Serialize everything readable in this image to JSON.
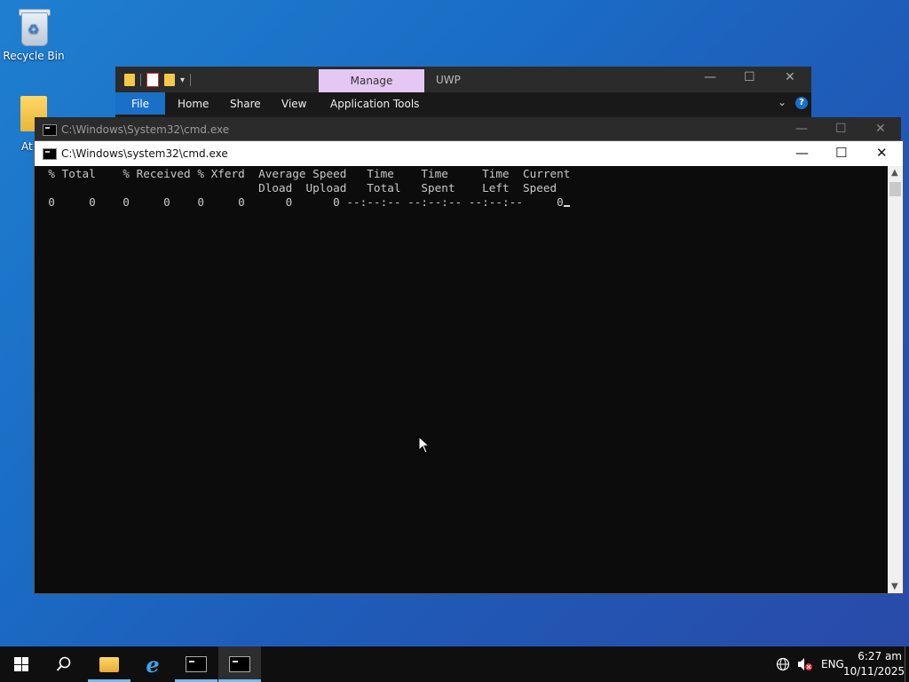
{
  "desktop": {
    "recycle_bin_label": "Recycle Bin",
    "folder_partial_label": "At"
  },
  "explorer": {
    "ribbon_context_tab": "Manage",
    "title_text": "UWP",
    "ribbon_tabs": [
      "File",
      "Home",
      "Share",
      "View",
      "Application Tools"
    ],
    "help_label": "?",
    "controls": {
      "minimize": "—",
      "maximize": "☐",
      "close": "✕"
    }
  },
  "cmd_back": {
    "title": "C:\\Windows\\System32\\cmd.exe",
    "controls": {
      "minimize": "—",
      "maximize": "☐",
      "close": "✕"
    }
  },
  "cmd_front": {
    "title": "C:\\Windows\\system32\\cmd.exe",
    "controls": {
      "minimize": "—",
      "maximize": "☐",
      "close": "✕"
    },
    "lines": [
      "  % Total    % Received % Xferd  Average Speed   Time    Time     Time  Current",
      "                                 Dload  Upload   Total   Spent    Left  Speed",
      "  0     0    0     0    0     0      0      0 --:--:-- --:--:-- --:--:--     0"
    ]
  },
  "taskbar": {
    "apps": [
      "start",
      "search",
      "file-explorer",
      "internet-explorer",
      "cmd",
      "cmd"
    ],
    "tray": {
      "language": "ENG",
      "time": "6:27 am",
      "date": "10/11/2025"
    }
  },
  "colors": {
    "desktop_accent": "#1f7fd0",
    "manage_tab": "#e4c7f2",
    "file_tab": "#1a6fc7",
    "console_bg": "#0c0c0c"
  }
}
